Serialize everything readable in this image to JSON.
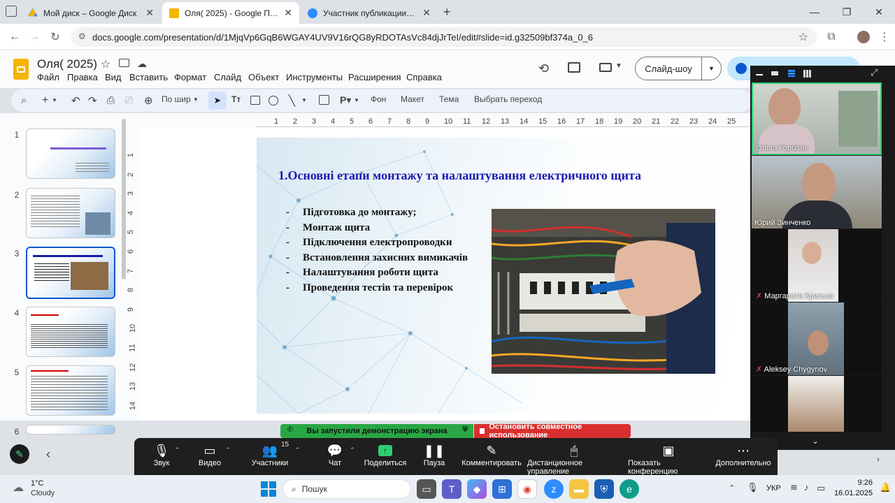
{
  "browser": {
    "tabs": [
      {
        "title": "Мой диск – Google Диск",
        "color": "#1a73e8"
      },
      {
        "title": "Оля( 2025) - Google Презентации",
        "color": "#f4b400"
      },
      {
        "title": "Участник публикации - Zoom",
        "color": "#2d8cff"
      }
    ],
    "url": "docs.google.com/presentation/d/1MjqVp6GqB6WGAY4UV9V16rQG8yRDOTAsVc84djJrTeI/edit#slide=id.g32509bf374a_0_6"
  },
  "docs": {
    "title": "Оля( 2025)",
    "menu": [
      "Файл",
      "Правка",
      "Вид",
      "Вставить",
      "Формат",
      "Слайд",
      "Объект",
      "Инструменты",
      "Расширения",
      "Справка"
    ],
    "slideshow_label": "Слайд-шоу",
    "toolbar": {
      "zoom": "По шир",
      "bg": "Фон",
      "layout": "Макет",
      "theme": "Тема",
      "transition": "Выбрать переход"
    },
    "ruler": [
      "1",
      "2",
      "3",
      "4",
      "5",
      "6",
      "7",
      "8",
      "9",
      "10",
      "11",
      "12",
      "13",
      "14",
      "15",
      "16",
      "17",
      "18",
      "19",
      "20",
      "21",
      "22",
      "23",
      "24",
      "25"
    ],
    "vruler": [
      "1",
      "2",
      "3",
      "4",
      "5",
      "6",
      "7",
      "8",
      "9",
      "10",
      "11",
      "12",
      "13",
      "14"
    ],
    "thumb_numbers": [
      "1",
      "2",
      "3",
      "4",
      "5",
      "6"
    ],
    "selected_slide": 3
  },
  "slide": {
    "title": "1.Основні етапи монтажу та налаштування електричного щита",
    "bullets": [
      "Підготовка до монтажу;",
      "Монтаж щита",
      "Підключення електропроводки",
      "Встановлення захисних вимикачів",
      "Налаштування роботи щита",
      "Проведення тестів та перевірок"
    ]
  },
  "share": {
    "status": "Вы запустили демонстрацию экрана",
    "stop": "Остановить совместное использование"
  },
  "participants": [
    "Ольга Горбань",
    "Юрий Зинченко",
    "Маргарита Крисько",
    "Aleksey Chygynov"
  ],
  "zoom_toolbar": {
    "participant_count": "15",
    "items": [
      "Звук",
      "Видео",
      "Участники",
      "Чат",
      "Поделиться",
      "Пауза",
      "Комментировать",
      "Дистанционное управление",
      "Показать конференцию",
      "Дополнительно"
    ]
  },
  "taskbar": {
    "temp": "1°C",
    "weather": "Cloudy",
    "search": "Пошук",
    "lang": "УКР",
    "time": "9:26",
    "date": "16.01.2025"
  }
}
